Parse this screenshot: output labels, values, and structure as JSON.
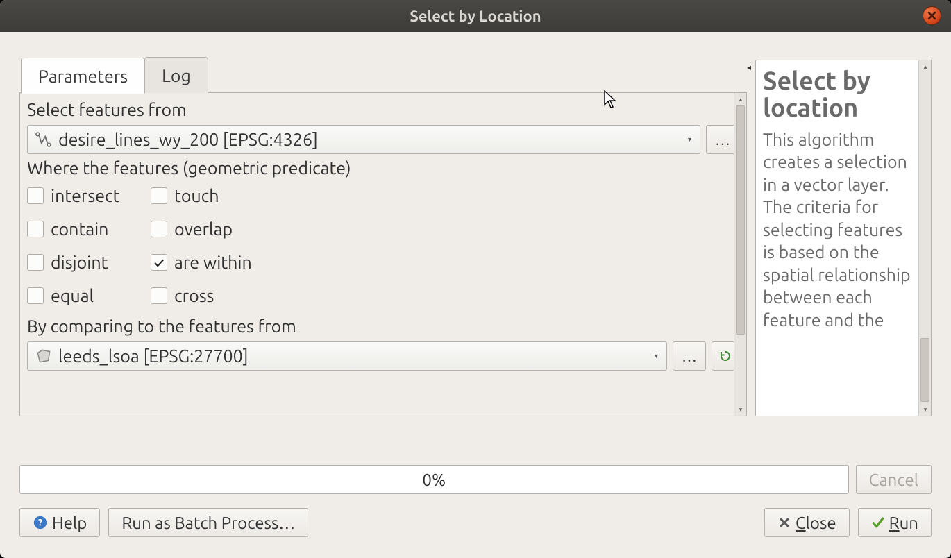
{
  "window": {
    "title": "Select by Location"
  },
  "tabs": {
    "parameters": "Parameters",
    "log": "Log"
  },
  "params": {
    "select_from_label": "Select features from",
    "select_from_value": "desire_lines_wy_200 [EPSG:4326]",
    "predicate_label": "Where the features (geometric predicate)",
    "cb_intersect": "intersect",
    "cb_touch": "touch",
    "cb_contain": "contain",
    "cb_overlap": "overlap",
    "cb_disjoint": "disjoint",
    "cb_arewithin": "are within",
    "cb_equal": "equal",
    "cb_cross": "cross",
    "compare_label": "By comparing to the features from",
    "compare_value": "leeds_lsoa [EPSG:27700]",
    "ellipsis": "…"
  },
  "help": {
    "title": "Select by location",
    "body": "This algorithm creates a selection in a vector layer. The criteria for selecting features is based on the spatial relationship between each feature and the"
  },
  "progress": {
    "text": "0%"
  },
  "buttons": {
    "cancel": "Cancel",
    "help": "Help",
    "run_batch": "Run as Batch Process…",
    "close_pre": "C",
    "close_post": "lose",
    "run_pre": "R",
    "run_post": "un"
  }
}
